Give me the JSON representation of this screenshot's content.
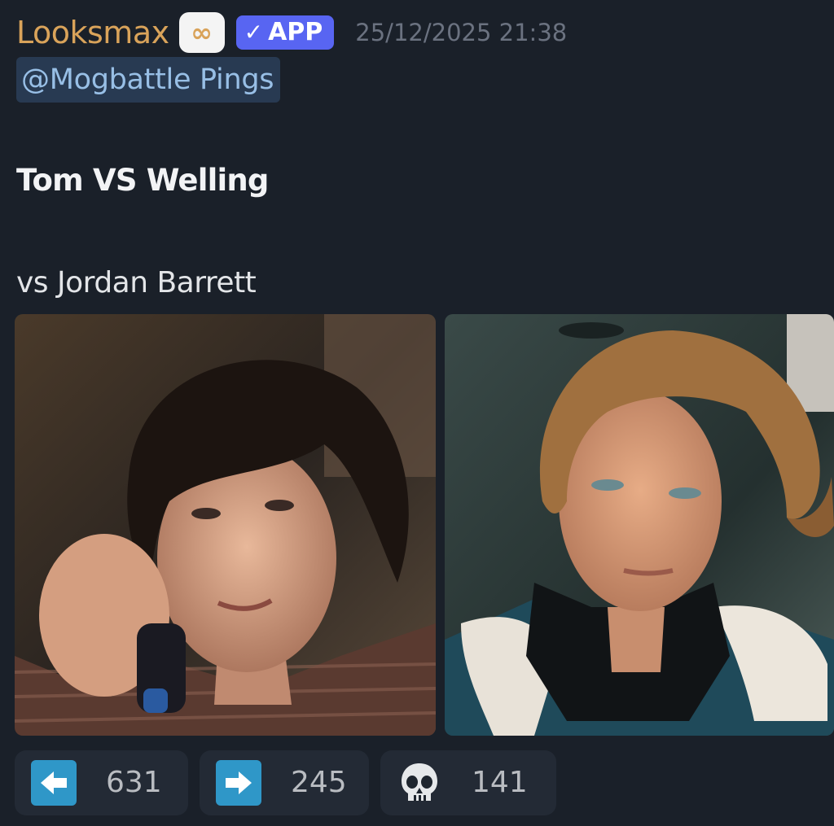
{
  "message": {
    "author": "Looksmax",
    "server_tag_icon": "infinity-icon",
    "server_tag_glyph": "∞",
    "app_badge": "APP",
    "timestamp": "25/12/2025 21:38",
    "mention": "@Mogbattle Pings",
    "title": "Tom VS Welling",
    "subtitle": "vs Jordan Barrett",
    "colors": {
      "author": "#d9a35a",
      "app_badge_bg": "#5865f2",
      "mention_bg": "#283a52",
      "mention_text": "#98bfe6",
      "reaction_icon_bg": "#2f97c8"
    }
  },
  "attachments": [
    {
      "kind": "photo",
      "icon": "photo-left"
    },
    {
      "kind": "photo",
      "icon": "photo-right"
    }
  ],
  "reactions": [
    {
      "icon": "left-arrow-icon",
      "count": "631"
    },
    {
      "icon": "right-arrow-icon",
      "count": "245"
    },
    {
      "icon": "skull-icon",
      "count": "141"
    }
  ]
}
